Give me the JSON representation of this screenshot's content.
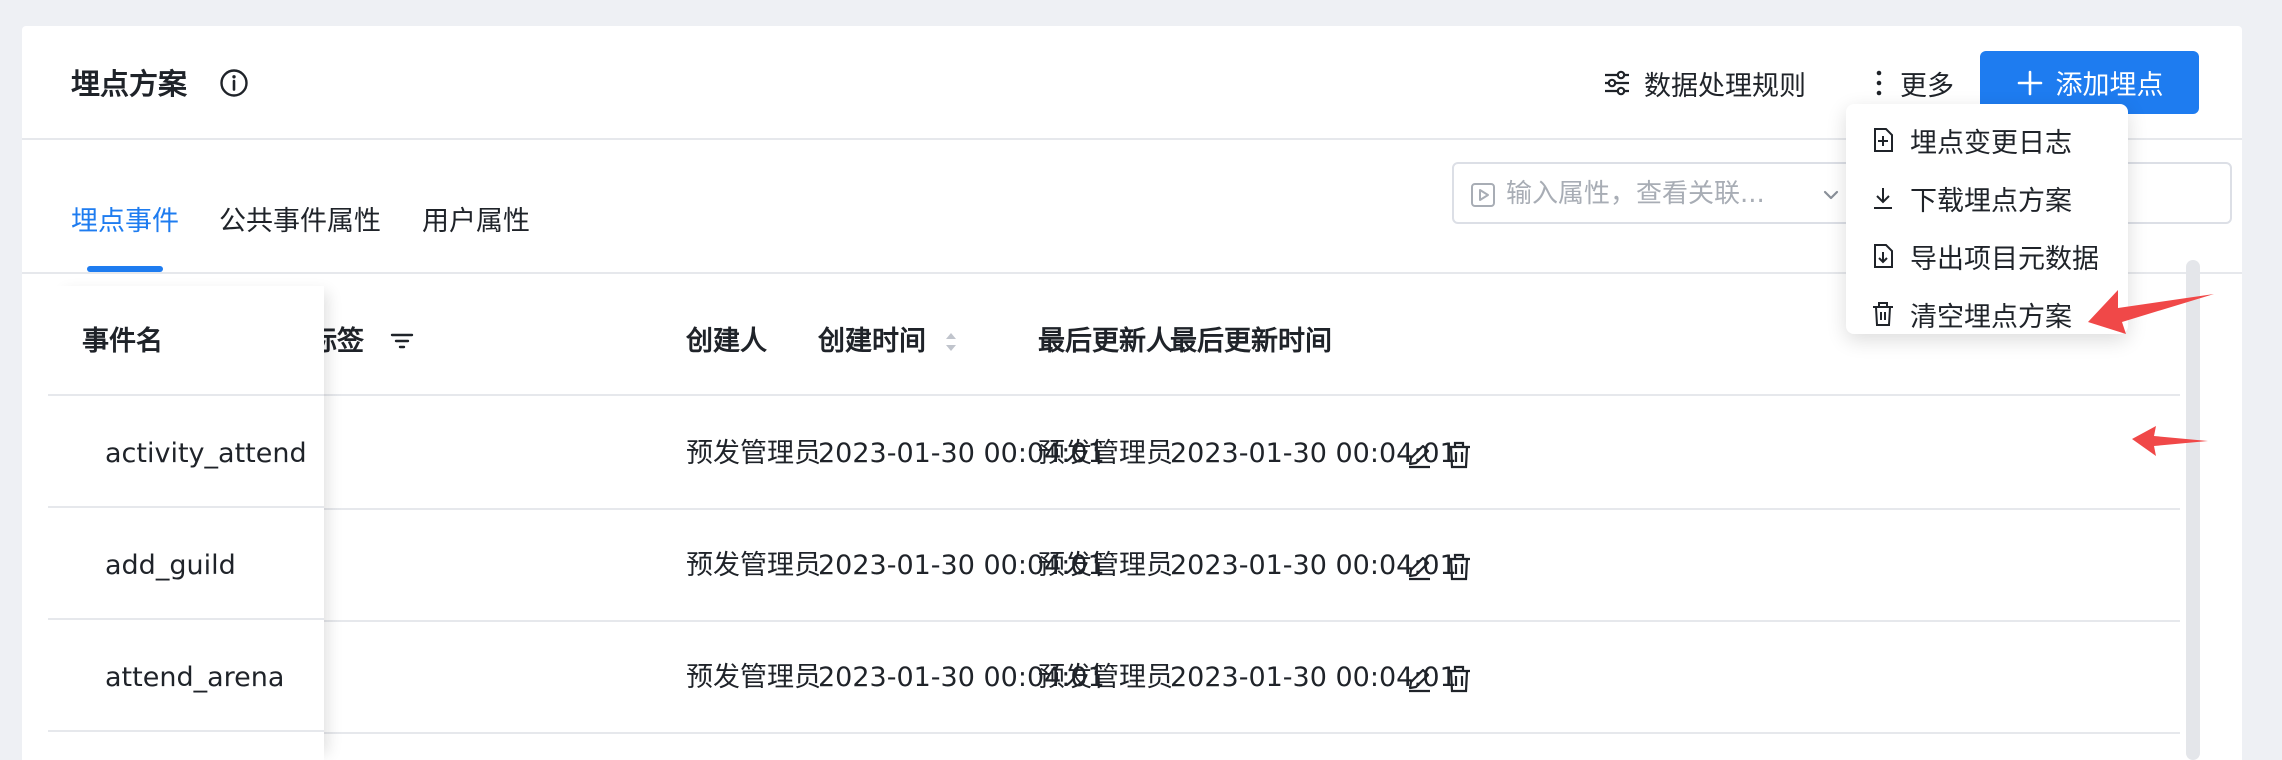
{
  "header": {
    "title": "埋点方案",
    "rules_label": "数据处理规则",
    "more_label": "更多",
    "add_label": "添加埋点"
  },
  "tabs": [
    {
      "label": "埋点事件",
      "active": true
    },
    {
      "label": "公共事件属性",
      "active": false
    },
    {
      "label": "用户属性",
      "active": false
    }
  ],
  "property_select": {
    "placeholder": "输入属性，查看关联..."
  },
  "dropdown": {
    "items": [
      {
        "label": "埋点变更日志",
        "icon": "file-add-icon"
      },
      {
        "label": "下载埋点方案",
        "icon": "download-icon"
      },
      {
        "label": "导出项目元数据",
        "icon": "export-icon"
      },
      {
        "label": "清空埋点方案",
        "icon": "trash-icon"
      }
    ]
  },
  "table": {
    "columns": {
      "event_name": "事件名",
      "tags": "标签",
      "creator": "创建人",
      "created_at": "创建时间",
      "updater": "最后更新人",
      "updated_at": "最后更新时间"
    },
    "rows": [
      {
        "event_name": "activity_attend",
        "creator": "预发管理员",
        "created_at": "2023-01-30 00:04:01",
        "updater": "预发管理员",
        "updated_at": "2023-01-30 00:04:01"
      },
      {
        "event_name": "add_guild",
        "creator": "预发管理员",
        "created_at": "2023-01-30 00:04:01",
        "updater": "预发管理员",
        "updated_at": "2023-01-30 00:04:01"
      },
      {
        "event_name": "attend_arena",
        "creator": "预发管理员",
        "created_at": "2023-01-30 00:04:01",
        "updater": "预发管理员",
        "updated_at": "2023-01-30 00:04:01"
      }
    ]
  },
  "colors": {
    "accent": "#1e7cf0",
    "annotation_arrow": "#f04848",
    "border": "#e6e8ec",
    "background": "#eef0f4"
  }
}
